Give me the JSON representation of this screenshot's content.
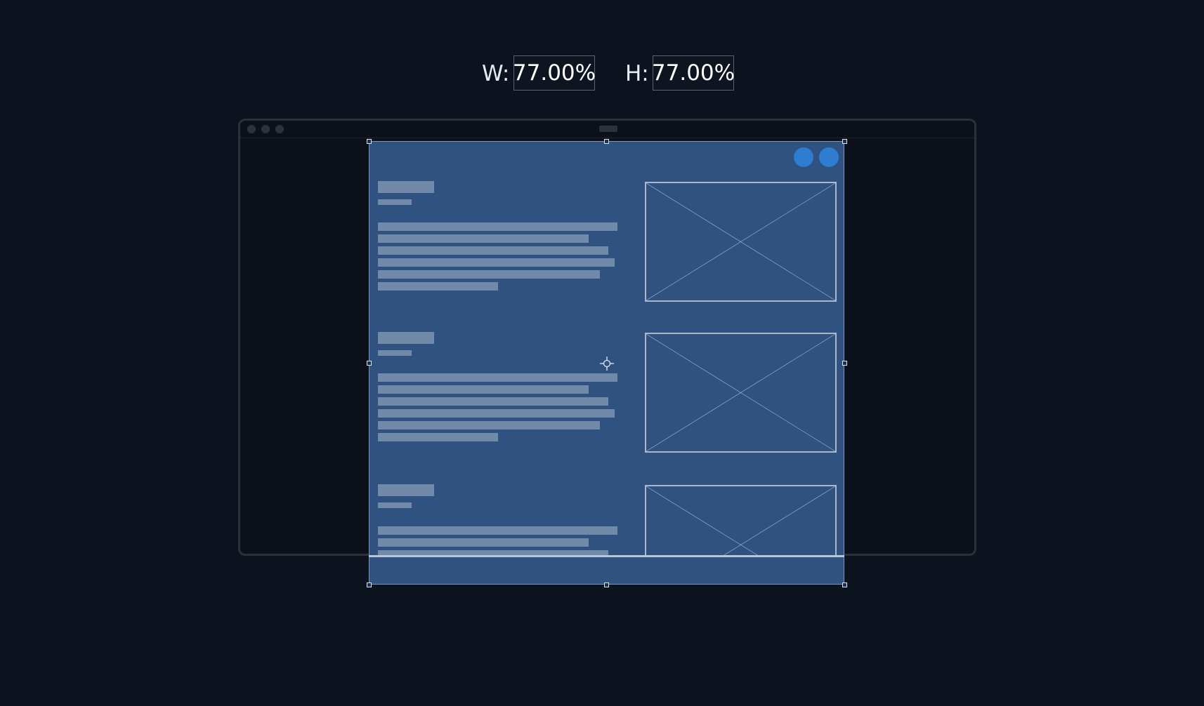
{
  "dimensions": {
    "width_label": "W:",
    "width_value": "77.00%",
    "height_label": "H:",
    "height_value": "77.00%"
  },
  "overlay": {
    "scale": {
      "width_percent": 77.0,
      "height_percent": 77.0
    }
  },
  "colors": {
    "background": "#0d131e",
    "blueprint_fill": "#2f5281",
    "accent_circle": "#2f7dd1",
    "handle_border": "#dfe6f0"
  },
  "icons": [
    "crosshair-icon",
    "resize-handle-icon",
    "image-placeholder-icon"
  ]
}
